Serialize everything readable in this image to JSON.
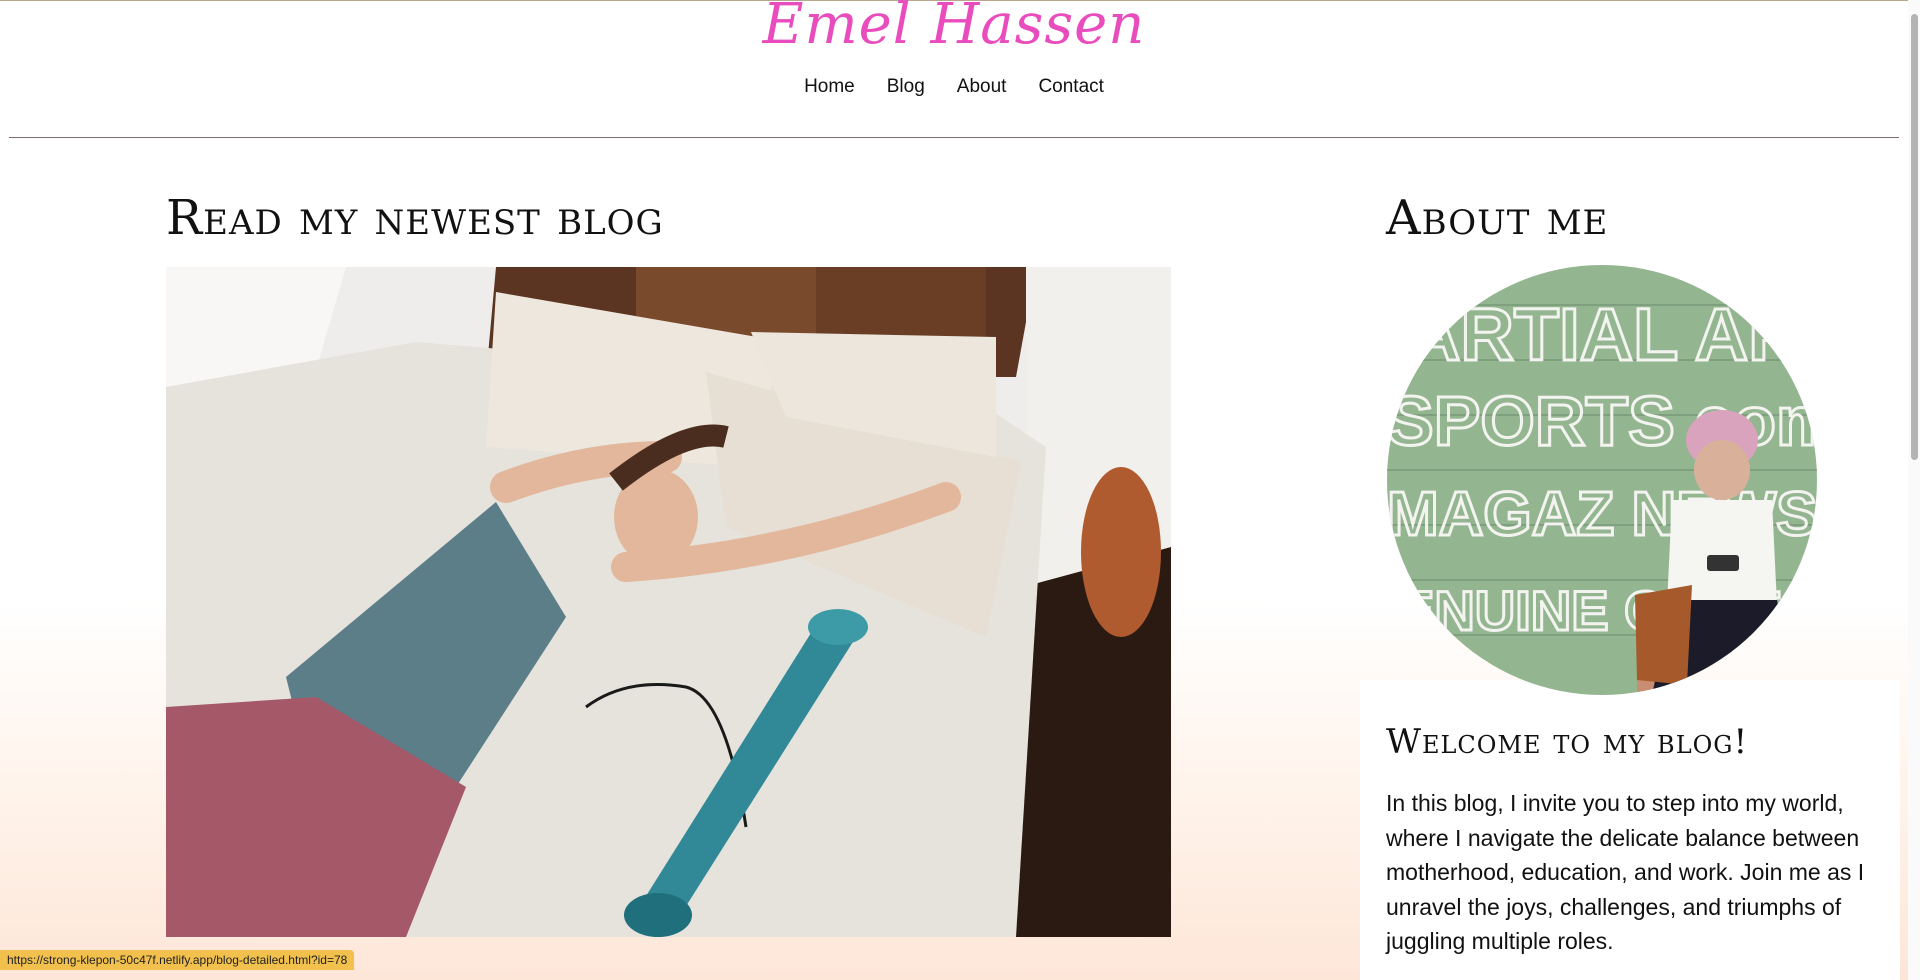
{
  "site": {
    "logo_text": "Emel Hassen"
  },
  "nav": {
    "items": [
      {
        "label": "Home"
      },
      {
        "label": "Blog"
      },
      {
        "label": "About"
      },
      {
        "label": "Contact"
      }
    ]
  },
  "main": {
    "heading": "Read my newest blog"
  },
  "sidebar": {
    "heading": "About me",
    "welcome_heading": "Welcome to my blog!",
    "intro_text": "In this blog, I invite you to step into my world, where I navigate the delicate balance between motherhood, education, and work. Join me as I unravel the joys, challenges, and triumphs of juggling multiple roles.",
    "mural_lines": [
      "ARTIAL ARTS",
      "SPORTS comic",
      "MAGAZ NEWS",
      "ENUINE CARTOO"
    ]
  },
  "status_bar": {
    "url": "https://strong-klepon-50c47f.netlify.app/blog-detailed.html?id=78"
  },
  "colors": {
    "logo": "#e94cbd",
    "status_bar": "#f2c14d",
    "bottom_gradient": "#fde6d8"
  }
}
